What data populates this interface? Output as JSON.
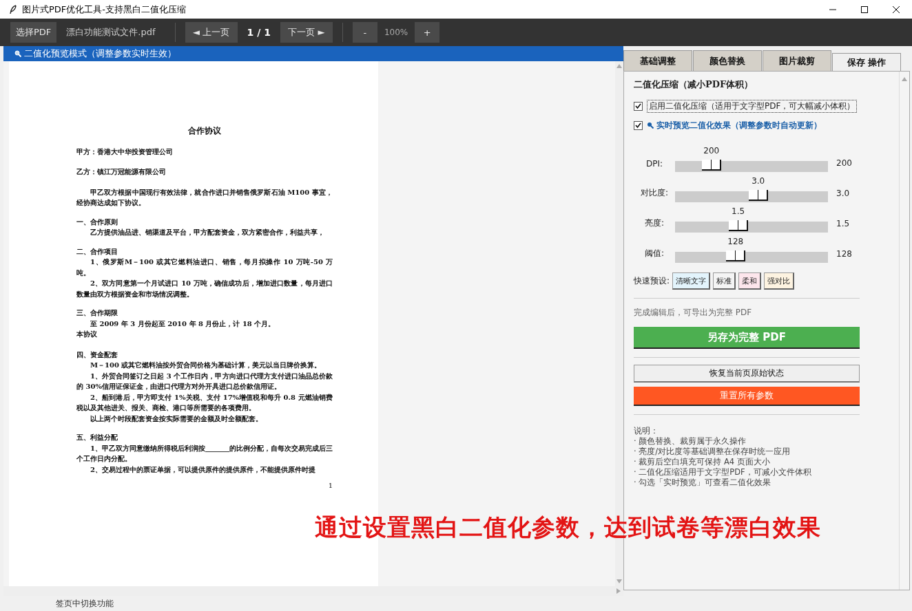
{
  "window": {
    "title": "图片式PDF优化工具-支持黑白二值化压缩"
  },
  "toolbar": {
    "open_button": "选择PDF",
    "file_name": "漂白功能测试文件.pdf",
    "prev_button": "◄ 上一页",
    "page_indicator": "1 / 1",
    "next_button": "下一页 ►",
    "zoom_out_button": "-",
    "zoom_level": "100%",
    "zoom_in_button": "+"
  },
  "preview": {
    "banner": "二值化预览模式（调整参数实时生效）",
    "document": [
      {
        "kind": "title",
        "text": "合作协议"
      },
      {
        "kind": "line",
        "text": "甲方：香港大中华投资管理公司"
      },
      {
        "kind": "line",
        "text": "乙方：镇江万冠能源有限公司"
      },
      {
        "kind": "para",
        "text": "甲乙双方根据中国现行有效法律，就合作进口并销售俄罗斯石油 M100 事宜，经协商达成如下协议。"
      },
      {
        "kind": "heading",
        "text": "一、合作原则"
      },
      {
        "kind": "para",
        "text": "乙方提供油品进、销渠道及平台，甲方配套资金，双方紧密合作，利益共享，"
      },
      {
        "kind": "heading",
        "text": "二、合作项目"
      },
      {
        "kind": "para",
        "text": "1、俄罗斯M－100 或其它燃料油进口、销售，每月拟操作 10 万吨-50 万吨。"
      },
      {
        "kind": "para",
        "text": "2、双方同意第一个月试进口 10 万吨，确信成功后，增加进口数量，每月进口数量由双方根据资金和市场情况调整。"
      },
      {
        "kind": "heading",
        "text": "三、合作期限"
      },
      {
        "kind": "para",
        "text": "至 2009 年 3 月份起至 2010 年 8 月份止，计 18 个月。"
      },
      {
        "kind": "line",
        "text": "本协议"
      },
      {
        "kind": "heading",
        "text": "四、资金配套"
      },
      {
        "kind": "para",
        "text": "M－100 或其它燃料油按外贸合同价格为基础计算，美元以当日牌价换算。"
      },
      {
        "kind": "para",
        "text": "1、外贸合同签订之日起 3 个工作日内，甲方向进口代理方支付进口油品总价款的 30%信用证保证金，由进口代理方对外开具进口总价款信用证。"
      },
      {
        "kind": "para",
        "text": "2、船到港后，甲方即支付 1%关税、支付 17%增值税和每升 0.8 元燃油销费税以及其他进关、报关、商检、港口等所需要的各项费用。"
      },
      {
        "kind": "para",
        "text": "以上两个时段配套资金按实际需要的金额及时全额配套。"
      },
      {
        "kind": "heading",
        "text": "五、利益分配"
      },
      {
        "kind": "para",
        "text": "1、甲乙双方同意缴纳所得税后利润按_______的比例分配，自每次交易完成后三个工作日内分配。"
      },
      {
        "kind": "para",
        "text": "2、交易过程中的票证单据，可以提供原件的提供原件，不能提供原件时提"
      },
      {
        "kind": "pagenum",
        "text": "1"
      }
    ]
  },
  "side_panel": {
    "tabs": [
      {
        "label": "基础调整",
        "selected": false
      },
      {
        "label": "颜色替换",
        "selected": false
      },
      {
        "label": "图片裁剪",
        "selected": false
      },
      {
        "label": "保存 操作",
        "selected": true
      }
    ],
    "section_title": "二值化压缩（减小PDF体积）",
    "options": [
      {
        "kind": "option",
        "label": "启用二值化压缩（适用于文字型PDF，可大幅减小体积）",
        "checked": true
      },
      {
        "kind": "preview",
        "label": "实时预览二值化效果（调整参数时自动更新）",
        "checked": true
      }
    ],
    "sliders": [
      {
        "label": "DPI:",
        "value": "200",
        "level": 0.2,
        "reading": "200"
      },
      {
        "label": "对比度:",
        "value": "3.0",
        "level": 0.55,
        "reading": "3.0"
      },
      {
        "label": "亮度:",
        "value": "1.5",
        "level": 0.4,
        "reading": "1.5"
      },
      {
        "label": "阈值:",
        "value": "128",
        "level": 0.38,
        "reading": "128"
      }
    ],
    "presets_label": "快速预设:",
    "presets": [
      {
        "label": "清晰文字",
        "color": "#e3f4fc"
      },
      {
        "label": "标准",
        "color": "#f4f4f4"
      },
      {
        "label": "柔和",
        "color": "#fde6ec"
      },
      {
        "label": "强对比",
        "color": "#fdf3e1"
      }
    ],
    "export_hint": "完成编辑后，可导出为完整 PDF",
    "save_button": "另存为完整 PDF",
    "restore_button": "恢复当前页原始状态",
    "reset_button": "重置所有参数",
    "notes_title": "说明：",
    "notes": [
      "· 颜色替换、裁剪属于永久操作",
      "· 亮度/对比度等基础调整在保存时统一应用",
      "· 裁剪后空白填充可保持 A4 页面大小",
      "· 二值化压缩适用于文字型PDF，可减小文件体积",
      "· 勾选「实时预览」可查看二值化效果"
    ]
  },
  "status_bar": {
    "text": "签页中切换功能"
  },
  "annotation": {
    "text": "通过设置黑白二值化参数，达到试卷等漂白效果"
  }
}
